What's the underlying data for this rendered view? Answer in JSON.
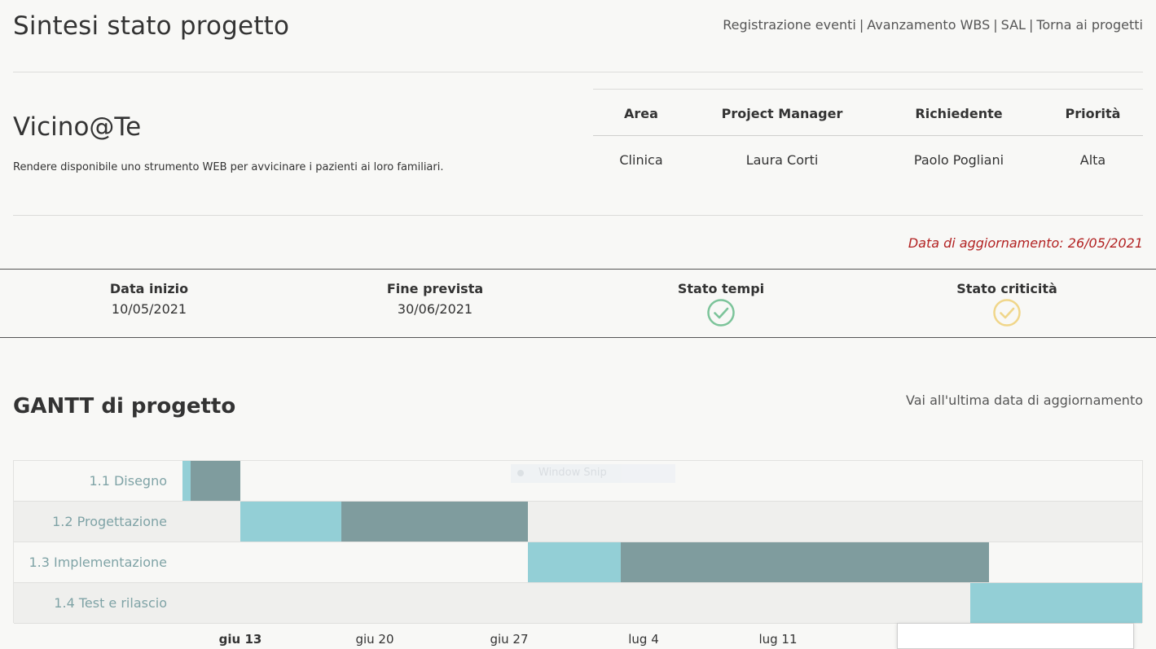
{
  "page": {
    "title": "Sintesi stato progetto",
    "nav": [
      {
        "label": "Registrazione eventi"
      },
      {
        "label": "Avanzamento WBS"
      },
      {
        "label": "SAL"
      },
      {
        "label": "Torna ai progetti"
      }
    ],
    "nav_separator": "|"
  },
  "project": {
    "name": "Vicino@Te",
    "description": "Rendere disponibile uno strumento WEB per avvicinare i pazienti ai loro familiari.",
    "table": {
      "headers": [
        "Area",
        "Project Manager",
        "Richiedente",
        "Priorità"
      ],
      "values": [
        "Clinica",
        "Laura Corti",
        "Paolo Pogliani",
        "Alta"
      ]
    },
    "update_date": "Data di aggiornamento: 26/05/2021"
  },
  "status": {
    "start_label": "Data inizio",
    "start_value": "10/05/2021",
    "end_label": "Fine prevista",
    "end_value": "30/06/2021",
    "time_label": "Stato tempi",
    "time_icon": "check-circle-icon",
    "time_color": "#7cc49a",
    "risk_label": "Stato criticità",
    "risk_icon": "check-circle-icon",
    "risk_color": "#f0d68a"
  },
  "gantt": {
    "title": "GANTT di progetto",
    "link": "Vai all'ultima data di aggiornamento",
    "colors": {
      "completed": "#93cfd6",
      "remaining": "#7f9c9e"
    },
    "tasks": [
      {
        "label": "1.1 Disegno"
      },
      {
        "label": "1.2 Progettazione"
      },
      {
        "label": "1.3 Implementazione"
      },
      {
        "label": "1.4 Test e rilascio"
      }
    ],
    "axis": [
      "giu 13",
      "giu 20",
      "giu 27",
      "lug 4",
      "lug 11"
    ]
  },
  "overlay": {
    "snip_text": "Window Snip"
  }
}
